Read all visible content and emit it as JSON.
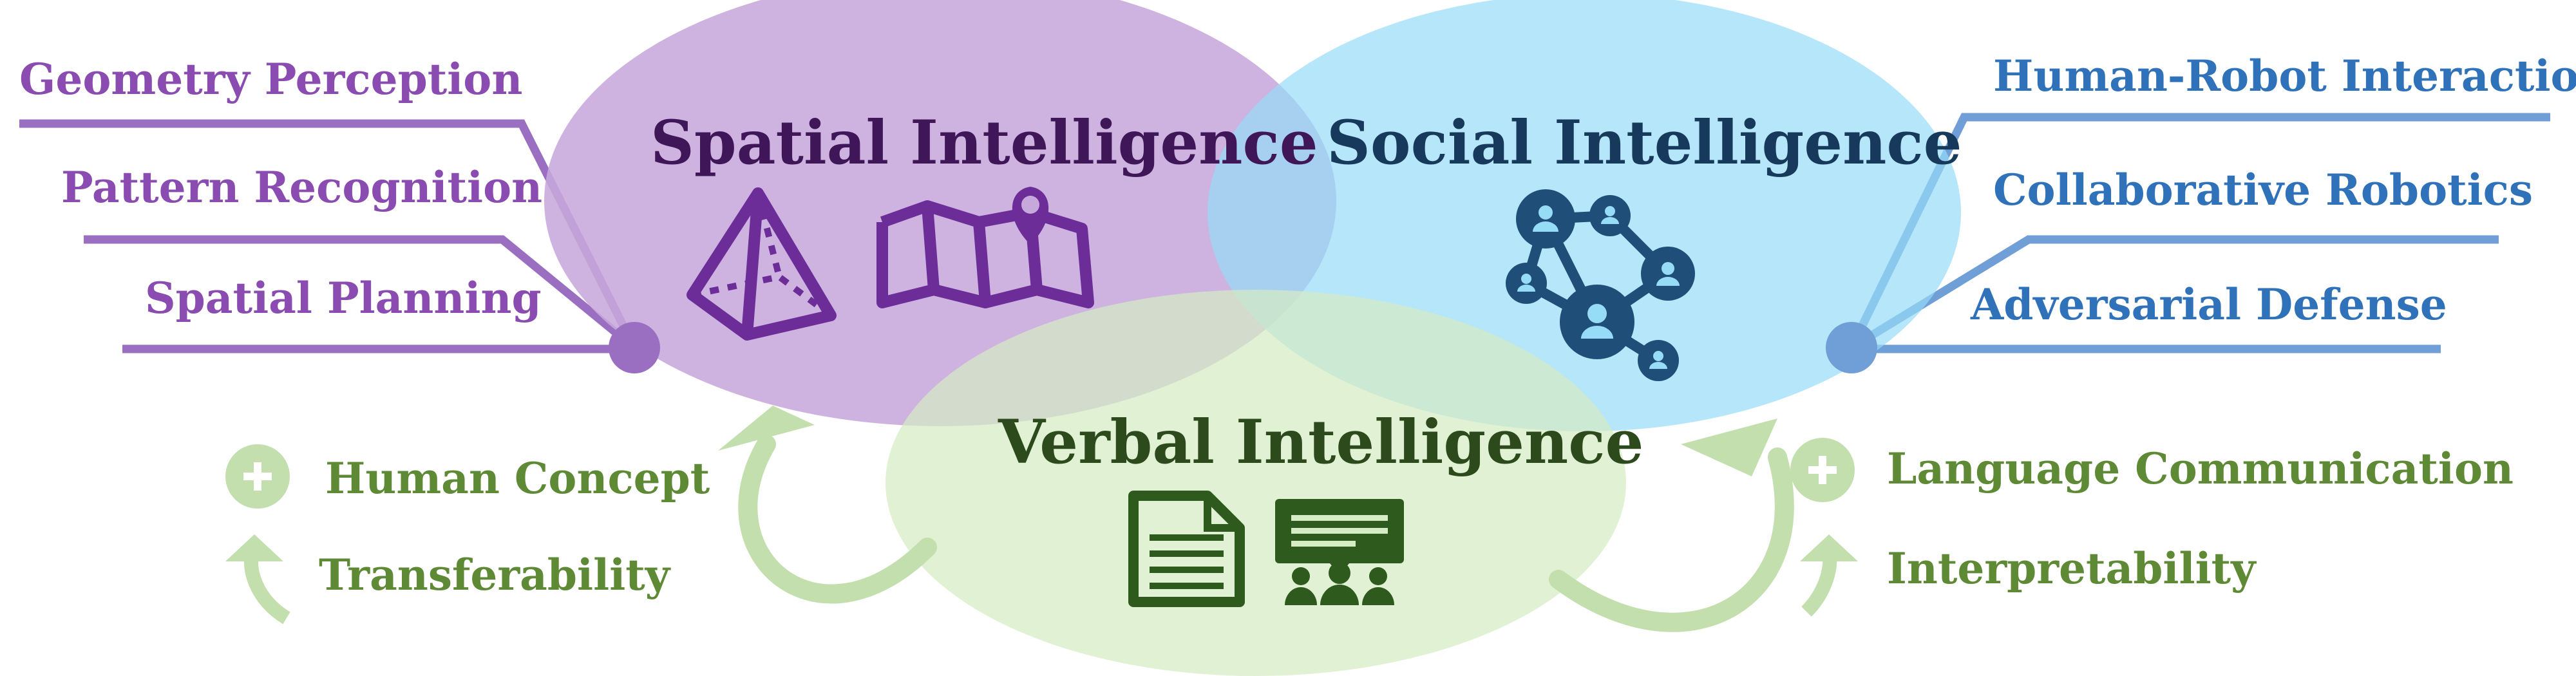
{
  "spatial": {
    "title": "Spatial Intelligence",
    "items": [
      "Geometry Perception",
      "Pattern Recognition",
      "Spatial Planning"
    ],
    "icons": [
      "pyramid-icon",
      "map-pin-icon"
    ]
  },
  "social": {
    "title": "Social Intelligence",
    "items": [
      "Human-Robot Interaction",
      "Collaborative Robotics",
      "Adversarial Defense"
    ],
    "icons": [
      "network-icon"
    ]
  },
  "verbal": {
    "title": "Verbal Intelligence",
    "icons": [
      "document-icon",
      "presentation-group-icon"
    ]
  },
  "left_benefits": {
    "plus": "Human Concept",
    "arrow": "Transferability"
  },
  "right_benefits": {
    "plus": "Language Communication",
    "arrow": "Interpretability"
  },
  "colors": {
    "spatial_fill": "#c7a8dc",
    "social_fill": "#96dcf6",
    "verbal_fill": "#d6ecc4",
    "spatial_line": "#9a6fc2",
    "social_line": "#6f9fd6",
    "verbal_accent": "#c3dfae"
  }
}
